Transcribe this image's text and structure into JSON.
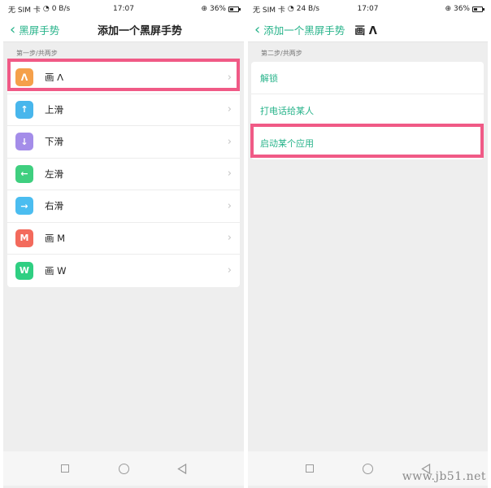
{
  "left": {
    "status": {
      "carrier": "无 SIM 卡",
      "speed": "0 B/s",
      "time": "17:07",
      "battery": "36%"
    },
    "nav": {
      "back_label": "黑屏手势",
      "title": "添加一个黑屏手势"
    },
    "step_label": "第一步/共两步",
    "gestures": [
      {
        "label": "画 ᐱ",
        "icon_text": "ᐱ",
        "icon_color": "#f5a04a",
        "icon": "caret-up-icon"
      },
      {
        "label": "上滑",
        "icon_text": "↑",
        "icon_color": "#48b6ec",
        "icon": "arrow-up-icon"
      },
      {
        "label": "下滑",
        "icon_text": "↓",
        "icon_color": "#a48de9",
        "icon": "arrow-down-icon"
      },
      {
        "label": "左滑",
        "icon_text": "←",
        "icon_color": "#3fcf7f",
        "icon": "arrow-left-icon"
      },
      {
        "label": "右滑",
        "icon_text": "→",
        "icon_color": "#4bbdf0",
        "icon": "arrow-right-icon"
      },
      {
        "label": "画 M",
        "icon_text": "M",
        "icon_color": "#f36a5c",
        "icon": "letter-m-icon"
      },
      {
        "label": "画 W",
        "icon_text": "W",
        "icon_color": "#2fcf82",
        "icon": "letter-w-icon"
      }
    ]
  },
  "right": {
    "status": {
      "carrier": "无 SIM 卡",
      "speed": "24 B/s",
      "time": "17:07",
      "battery": "36%"
    },
    "nav": {
      "back_label": "添加一个黑屏手势",
      "title": "画 ᐱ"
    },
    "step_label": "第二步/共两步",
    "actions": [
      {
        "label": "解锁"
      },
      {
        "label": "打电话给某人"
      },
      {
        "label": "启动某个应用"
      }
    ]
  },
  "watermark": "www.jb51.net",
  "colors": {
    "accent": "#27b38a",
    "highlight": "#f05a86"
  }
}
